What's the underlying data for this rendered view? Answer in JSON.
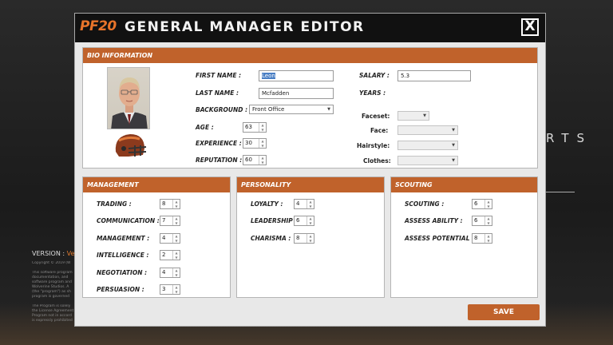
{
  "header": {
    "logo": "PF20",
    "title": "GENERAL MANAGER EDITOR",
    "close_label": "X"
  },
  "background": {
    "letters": "RTS",
    "version_label": "VERSION :",
    "version_value": "Ver",
    "copyright": "Copyright © 2019 (W",
    "legal_1": "This software program documentation, and software program and Wolverine Studios. A (the \"program\") as sh program is governed",
    "legal_2": "The Program is solely the License Agreement Program not in accord is expressly prohibited"
  },
  "bio": {
    "heading": "BIO INFORMATION",
    "first_name_label": "FIRST NAME :",
    "first_name_value": "Leon",
    "last_name_label": "LAST NAME :",
    "last_name_value": "Mcfadden",
    "background_label": "BACKGROUND :",
    "background_value": "Front Office",
    "age_label": "AGE :",
    "age_value": "63",
    "experience_label": "EXPERIENCE :",
    "experience_value": "30",
    "reputation_label": "REPUTATION :",
    "reputation_value": "60",
    "salary_label": "SALARY :",
    "salary_value": "5.3",
    "years_label": "YEARS :",
    "faceset_label": "Faceset:",
    "face_label": "Face:",
    "hairstyle_label": "Hairstyle:",
    "clothes_label": "Clothes:"
  },
  "management": {
    "heading": "MANAGEMENT",
    "trading_label": "TRADING :",
    "trading_value": "8",
    "communication_label": "COMMUNICATION :",
    "communication_value": "7",
    "management_label": "MANAGEMENT :",
    "management_value": "4",
    "intelligence_label": "INTELLIGENCE :",
    "intelligence_value": "2",
    "negotiation_label": "NEGOTIATION :",
    "negotiation_value": "4",
    "persuasion_label": "PERSUASION :",
    "persuasion_value": "3"
  },
  "personality": {
    "heading": "PERSONALITY",
    "loyalty_label": "LOYALTY :",
    "loyalty_value": "4",
    "leadership_label": "LEADERSHIP :",
    "leadership_value": "6",
    "charisma_label": "CHARISMA :",
    "charisma_value": "8"
  },
  "scouting": {
    "heading": "SCOUTING",
    "scouting_label": "SCOUTING :",
    "scouting_value": "6",
    "assess_ability_label": "ASSESS ABILITY :",
    "assess_ability_value": "6",
    "assess_potential_label": "ASSESS POTENTIAL :",
    "assess_potential_value": "8"
  },
  "footer": {
    "save_label": "SAVE"
  },
  "colors": {
    "accent": "#c0622b",
    "logo": "#e8742a",
    "titlebar": "#111111"
  }
}
